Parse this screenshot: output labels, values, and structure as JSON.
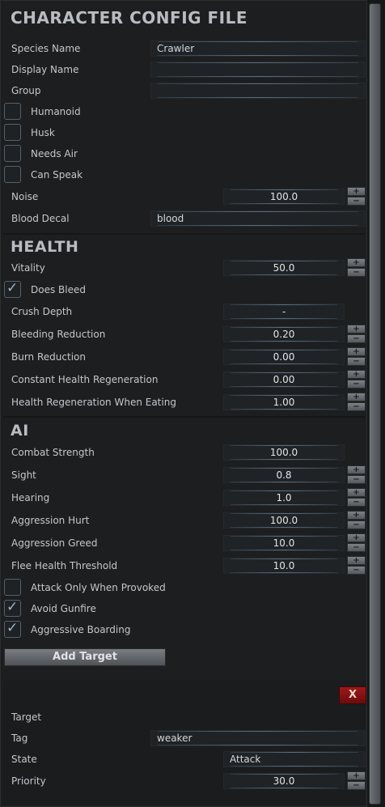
{
  "header": {
    "title": "CHARACTER CONFIG FILE"
  },
  "general": {
    "species_name": {
      "label": "Species Name",
      "value": "Crawler"
    },
    "display_name": {
      "label": "Display Name",
      "value": ""
    },
    "group": {
      "label": "Group",
      "value": ""
    },
    "humanoid": {
      "label": "Humanoid",
      "checked": false
    },
    "husk": {
      "label": "Husk",
      "checked": false
    },
    "needs_air": {
      "label": "Needs Air",
      "checked": false
    },
    "can_speak": {
      "label": "Can Speak",
      "checked": false
    },
    "noise": {
      "label": "Noise",
      "value": "100.0"
    },
    "blood_decal": {
      "label": "Blood Decal",
      "value": "blood"
    }
  },
  "health": {
    "title": "HEALTH",
    "vitality": {
      "label": "Vitality",
      "value": "50.0"
    },
    "does_bleed": {
      "label": "Does Bleed",
      "checked": true
    },
    "crush_depth": {
      "label": "Crush Depth",
      "value": "-"
    },
    "bleeding_reduction": {
      "label": "Bleeding Reduction",
      "value": "0.20"
    },
    "burn_reduction": {
      "label": "Burn Reduction",
      "value": "0.00"
    },
    "constant_regen": {
      "label": "Constant Health Regeneration",
      "value": "0.00"
    },
    "regen_eating": {
      "label": "Health Regeneration When Eating",
      "value": "1.00"
    }
  },
  "ai": {
    "title": "AI",
    "combat_strength": {
      "label": "Combat Strength",
      "value": "100.0"
    },
    "sight": {
      "label": "Sight",
      "value": "0.8"
    },
    "hearing": {
      "label": "Hearing",
      "value": "1.0"
    },
    "aggression_hurt": {
      "label": "Aggression Hurt",
      "value": "100.0"
    },
    "aggression_greed": {
      "label": "Aggression Greed",
      "value": "10.0"
    },
    "flee_health": {
      "label": "Flee Health Threshold",
      "value": "10.0"
    },
    "attack_only_provoked": {
      "label": "Attack Only When Provoked",
      "checked": false
    },
    "avoid_gunfire": {
      "label": "Avoid Gunfire",
      "checked": true
    },
    "aggressive_boarding": {
      "label": "Aggressive Boarding",
      "checked": true
    },
    "add_target_label": "Add Target"
  },
  "target": {
    "remove_label": "X",
    "target_label": "Target",
    "tag": {
      "label": "Tag",
      "value": "weaker"
    },
    "state": {
      "label": "State",
      "value": "Attack"
    },
    "priority": {
      "label": "Priority",
      "value": "30.0"
    }
  },
  "stepper": {
    "plus": "+",
    "minus": "−"
  },
  "colors": {
    "accent_line": "#5a6f82",
    "remove_button": "#a01818",
    "check": "#9cb4c8"
  }
}
